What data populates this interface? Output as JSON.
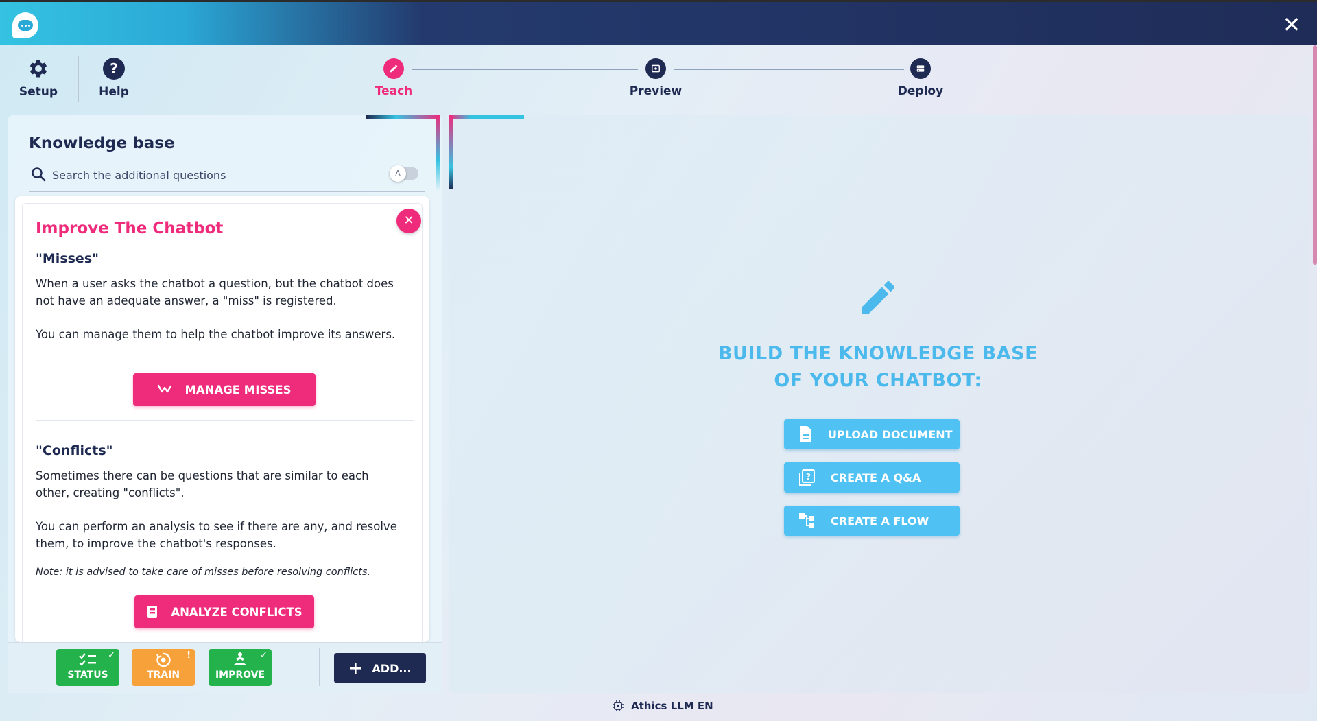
{
  "toolbar": {
    "setup_label": "Setup",
    "help_label": "Help"
  },
  "stepper": [
    {
      "label": "Teach",
      "state": "active"
    },
    {
      "label": "Preview",
      "state": "inactive"
    },
    {
      "label": "Deploy",
      "state": "inactive"
    }
  ],
  "knowledge_base": {
    "title": "Knowledge base",
    "search_placeholder": "Search the additional questions"
  },
  "improve_card": {
    "title": "Improve The Chatbot",
    "misses": {
      "title": "\"Misses\"",
      "text1": "When a user asks the chatbot a question, but the chatbot does not have an adequate answer, a \"miss\" is registered.",
      "text2": "You can manage them to help the chatbot improve its answers.",
      "button": "MANAGE MISSES"
    },
    "conflicts": {
      "title": "\"Conflicts\"",
      "text1": "Sometimes there can be questions that are similar to each other, creating \"conflicts\".",
      "text2": "You can perform an analysis to see if there are any, and resolve them, to improve the chatbot's responses.",
      "note": "Note: it is advised to take care of misses before resolving conflicts.",
      "button": "ANALYZE CONFLICTS"
    }
  },
  "status_bar": {
    "tiles": [
      {
        "label": "STATUS",
        "badge": "✓",
        "color": "#23b24b"
      },
      {
        "label": "TRAIN",
        "badge": "!",
        "color": "#f7a13a"
      },
      {
        "label": "IMPROVE",
        "badge": "✓",
        "color": "#23b24b"
      }
    ],
    "add_label": "ADD..."
  },
  "main": {
    "heading_line1": "BUILD THE KNOWLEDGE BASE",
    "heading_line2": "OF YOUR CHATBOT:",
    "buttons": [
      {
        "label": "UPLOAD DOCUMENT",
        "icon": "document-icon"
      },
      {
        "label": "CREATE A Q&A",
        "icon": "qa-icon"
      },
      {
        "label": "CREATE A FLOW",
        "icon": "flow-icon"
      }
    ]
  },
  "footer": {
    "model_label": "Athics LLM EN"
  },
  "colors": {
    "navy": "#1e2a52",
    "pink": "#ef2b7c",
    "cyan": "#4fc1f2",
    "green": "#23b24b",
    "orange": "#f7a13a"
  }
}
